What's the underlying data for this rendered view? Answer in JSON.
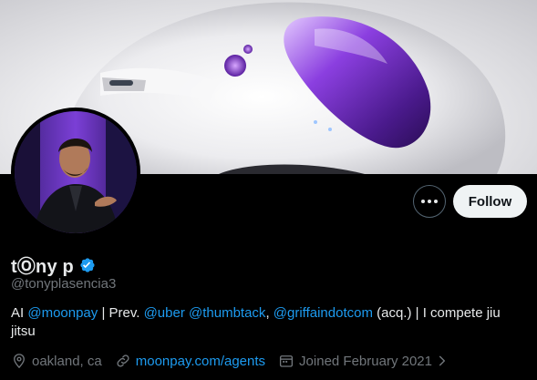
{
  "profile": {
    "display_name": "tⓄny p",
    "handle": "@tonyplasencia3",
    "verified": true,
    "bio": {
      "t1": "AI ",
      "m1": "@moonpay",
      "t2": " | Prev. ",
      "m2": "@uber",
      "t3": " ",
      "m3": "@thumbtack",
      "t4": ", ",
      "m4": "@griffaindotcom",
      "t5": " (acq.) | I compete jiu jitsu"
    },
    "location": "oakland, ca",
    "website": "moonpay.com/agents",
    "joined": "Joined February 2021"
  },
  "actions": {
    "follow_label": "Follow",
    "more_icon": "more-dots-icon"
  },
  "colors": {
    "accent": "#1d9bf0",
    "background": "#000000",
    "muted": "#71767b"
  }
}
